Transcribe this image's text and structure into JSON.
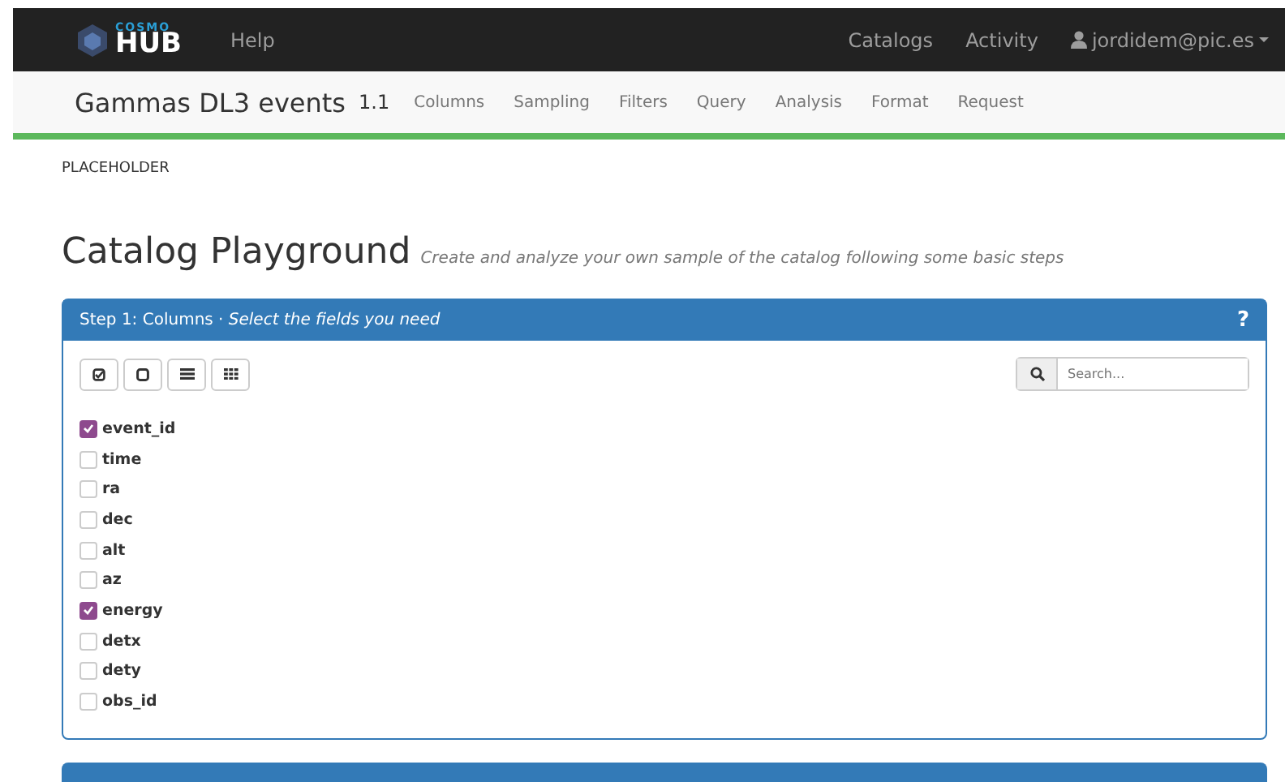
{
  "navbar": {
    "logo_top": "COSMO",
    "logo_main": "HUB",
    "links": [
      "Help"
    ],
    "right_links": [
      "Catalogs",
      "Activity"
    ],
    "user": "jordidem@pic.es"
  },
  "subnav": {
    "title": "Gammas DL3 events",
    "version": "1.1",
    "tabs": [
      "Columns",
      "Sampling",
      "Filters",
      "Query",
      "Analysis",
      "Format",
      "Request"
    ]
  },
  "placeholder_text": "PLACEHOLDER",
  "page": {
    "title": "Catalog Playground",
    "subtitle": "Create and analyze your own sample of the catalog following some basic steps"
  },
  "panel": {
    "step": "Step 1: Columns · ",
    "hint": "Select the fields you need",
    "help": "?",
    "search": {
      "placeholder": "Search..."
    },
    "fields": [
      {
        "name": "event_id",
        "checked": true
      },
      {
        "name": "time",
        "checked": false
      },
      {
        "name": "ra",
        "checked": false
      },
      {
        "name": "dec",
        "checked": false
      },
      {
        "name": "alt",
        "checked": false
      },
      {
        "name": "az",
        "checked": false
      },
      {
        "name": "energy",
        "checked": true
      },
      {
        "name": "detx",
        "checked": false
      },
      {
        "name": "dety",
        "checked": false
      },
      {
        "name": "obs_id",
        "checked": false
      }
    ]
  }
}
